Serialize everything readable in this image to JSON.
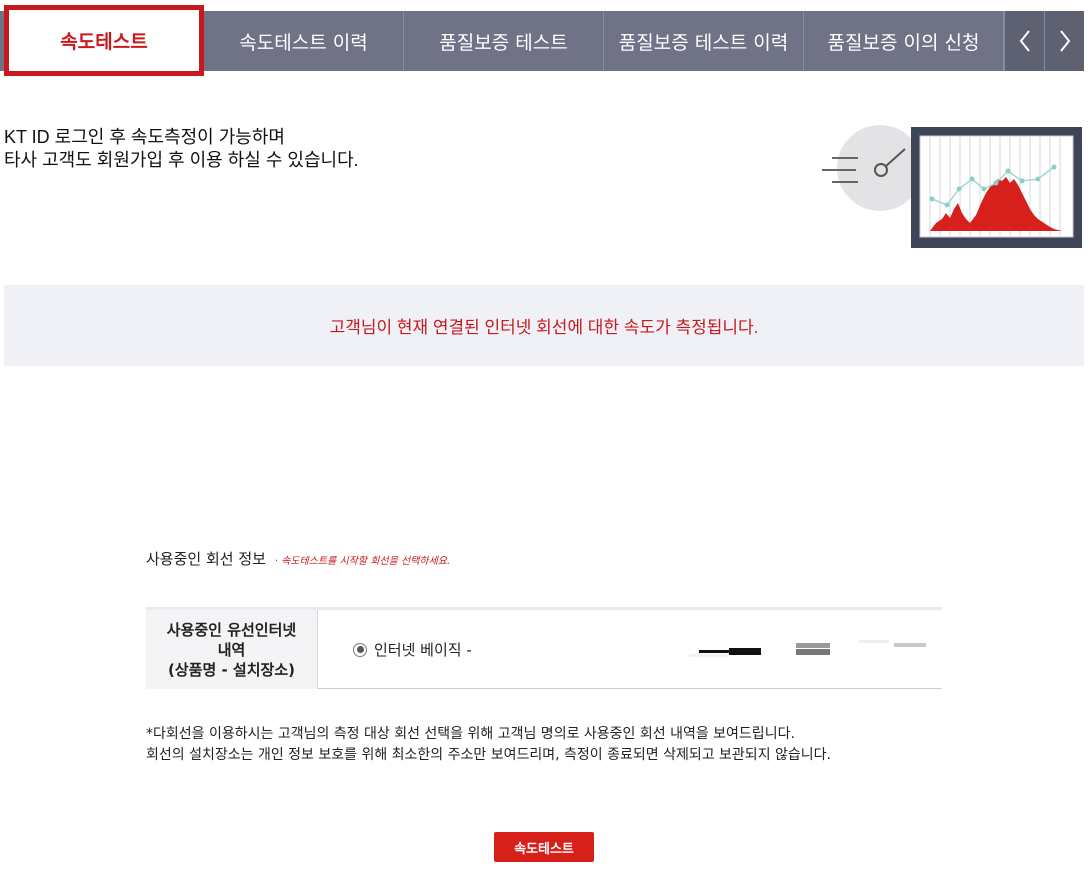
{
  "tabs": [
    {
      "label": "속도테스트",
      "active": true
    },
    {
      "label": "속도테스트 이력",
      "active": false
    },
    {
      "label": "품질보증 테스트",
      "active": false
    },
    {
      "label": "품질보증 테스트 이력",
      "active": false
    },
    {
      "label": "품질보증 이의 신청",
      "active": false
    }
  ],
  "nav": {
    "prev_icon": "chevron-left-icon",
    "next_icon": "chevron-right-icon"
  },
  "intro": {
    "line1": "KT ID 로그인 후 속도측정이 가능하며",
    "line2": "타사 고객도 회원가입 후 이용 하실 수 있습니다."
  },
  "notice": "고객님이 현재 연결된 인터넷 회선에 대한 속도가 측정됩니다.",
  "section": {
    "title": "사용중인 회선 정보",
    "hint": "· 속도테스트를 시작할 회선을 선택하세요."
  },
  "table": {
    "header_line1": "사용중인 유선인터넷",
    "header_line2": "내역",
    "header_line3": "(상품명 - 설치장소)",
    "option_label": "인터넷 베이직 -"
  },
  "note": {
    "line1": "*다회선을 이용하시는 고객님의 측정 대상 회선 선택을 위해 고객님 명의로 사용중인 회선 내역을 보여드립니다.",
    "line2": " 회선의 설치장소는 개인 정보 보호를 위해 최소한의 주소만 보여드리며, 측정이 종료되면 삭제되고 보관되지 않습니다."
  },
  "button": {
    "label": "속도테스트"
  },
  "colors": {
    "accent": "#c8191c",
    "tab_bg": "#6f7385",
    "notice_bg": "#f0f0f7",
    "button_bg": "#d8201b"
  }
}
